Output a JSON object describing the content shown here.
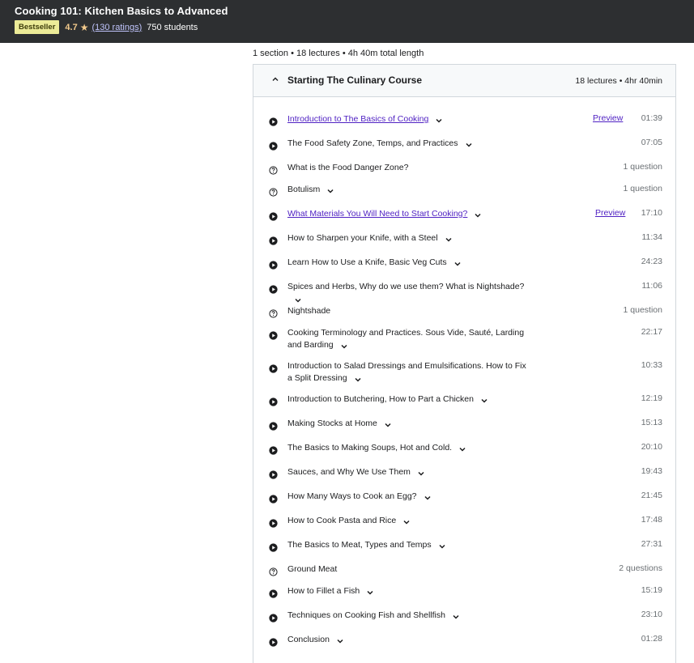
{
  "header": {
    "course_title": "Cooking 101: Kitchen Basics to Advanced",
    "badge": "Bestseller",
    "rating": "4.7",
    "ratings_count": "(130 ratings)",
    "students": "750 students",
    "colors": {
      "background": "#2d2f31",
      "badge": "#eceb98",
      "star": "#f3ca8c",
      "link": "#c0c4fc"
    }
  },
  "curriculum": {
    "summary": "1 section • 18 lectures • 4h 40m total length",
    "section": {
      "title": "Starting The Culinary Course",
      "meta": "18 lectures • 4hr 40min",
      "expanded_icon": "chevron-up-icon"
    },
    "lectures": [
      {
        "type": "video",
        "title": "Introduction to The Basics of Cooking",
        "link": true,
        "expandable": true,
        "preview": "Preview",
        "duration": "01:39"
      },
      {
        "type": "video",
        "title": "The Food Safety Zone, Temps, and Practices",
        "link": false,
        "expandable": true,
        "preview": "",
        "duration": "07:05"
      },
      {
        "type": "quiz",
        "title": "What is the Food Danger Zone?",
        "link": false,
        "expandable": false,
        "preview": "",
        "duration": "1 question"
      },
      {
        "type": "quiz",
        "title": "Botulism",
        "link": false,
        "expandable": true,
        "preview": "",
        "duration": "1 question"
      },
      {
        "type": "video",
        "title": "What Materials You Will Need to Start Cooking?",
        "link": true,
        "expandable": true,
        "preview": "Preview",
        "duration": "17:10"
      },
      {
        "type": "video",
        "title": "How to Sharpen your Knife, with a Steel",
        "link": false,
        "expandable": true,
        "preview": "",
        "duration": "11:34"
      },
      {
        "type": "video",
        "title": "Learn How to Use a Knife, Basic Veg Cuts",
        "link": false,
        "expandable": true,
        "preview": "",
        "duration": "24:23"
      },
      {
        "type": "video",
        "title": "Spices and Herbs, Why do we use them? What is Nightshade?",
        "link": false,
        "expandable": true,
        "preview": "",
        "duration": "11:06"
      },
      {
        "type": "quiz",
        "title": "Nightshade",
        "link": false,
        "expandable": false,
        "preview": "",
        "duration": "1 question"
      },
      {
        "type": "video",
        "title": "Cooking Terminology and Practices. Sous Vide, Sauté, Larding and Barding",
        "link": false,
        "expandable": true,
        "preview": "",
        "duration": "22:17"
      },
      {
        "type": "video",
        "title": "Introduction to Salad Dressings and Emulsifications. How to Fix a Split Dressing",
        "link": false,
        "expandable": true,
        "preview": "",
        "duration": "10:33"
      },
      {
        "type": "video",
        "title": "Introduction to Butchering, How to Part a Chicken",
        "link": false,
        "expandable": true,
        "preview": "",
        "duration": "12:19"
      },
      {
        "type": "video",
        "title": "Making Stocks at Home",
        "link": false,
        "expandable": true,
        "preview": "",
        "duration": "15:13"
      },
      {
        "type": "video",
        "title": "The Basics to Making Soups, Hot and Cold.",
        "link": false,
        "expandable": true,
        "preview": "",
        "duration": "20:10"
      },
      {
        "type": "video",
        "title": "Sauces, and Why We Use Them",
        "link": false,
        "expandable": true,
        "preview": "",
        "duration": "19:43"
      },
      {
        "type": "video",
        "title": "How Many Ways to Cook an Egg?",
        "link": false,
        "expandable": true,
        "preview": "",
        "duration": "21:45"
      },
      {
        "type": "video",
        "title": "How to Cook Pasta and Rice",
        "link": false,
        "expandable": true,
        "preview": "",
        "duration": "17:48"
      },
      {
        "type": "video",
        "title": "The Basics to Meat, Types and Temps",
        "link": false,
        "expandable": true,
        "preview": "",
        "duration": "27:31"
      },
      {
        "type": "quiz",
        "title": "Ground Meat",
        "link": false,
        "expandable": false,
        "preview": "",
        "duration": "2 questions"
      },
      {
        "type": "video",
        "title": "How to Fillet a Fish",
        "link": false,
        "expandable": true,
        "preview": "",
        "duration": "15:19"
      },
      {
        "type": "video",
        "title": "Techniques on Cooking Fish and Shellfish",
        "link": false,
        "expandable": true,
        "preview": "",
        "duration": "23:10"
      },
      {
        "type": "video",
        "title": "Conclusion",
        "link": false,
        "expandable": true,
        "preview": "",
        "duration": "01:28"
      }
    ],
    "icons": {
      "video": "play-circle-icon",
      "quiz": "question-circle-icon",
      "expand": "chevron-down-icon"
    }
  }
}
